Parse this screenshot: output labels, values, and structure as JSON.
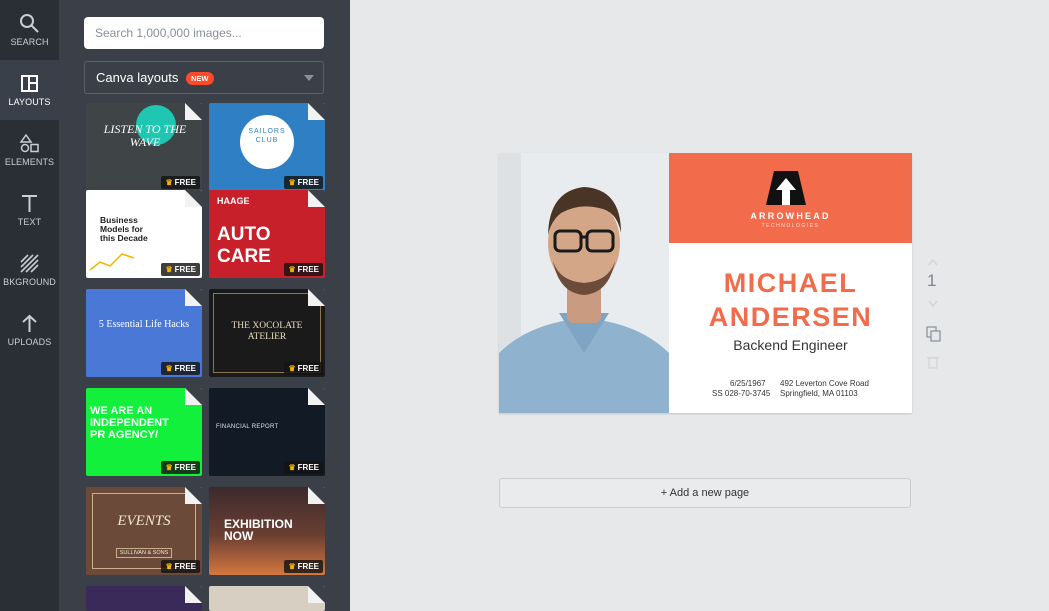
{
  "sidebar": {
    "items": [
      {
        "label": "SEARCH",
        "icon": "search-icon"
      },
      {
        "label": "LAYOUTS",
        "icon": "layouts-icon",
        "active": true
      },
      {
        "label": "ELEMENTS",
        "icon": "elements-icon"
      },
      {
        "label": "TEXT",
        "icon": "text-icon"
      },
      {
        "label": "BKGROUND",
        "icon": "background-icon"
      },
      {
        "label": "UPLOADS",
        "icon": "upload-icon"
      }
    ]
  },
  "panel": {
    "search_placeholder": "Search 1,000,000 images...",
    "layout_select": {
      "label": "Canva layouts",
      "badge": "NEW"
    },
    "free_label": "FREE",
    "templates": [
      {
        "title": "LISTEN TO THE WAVE"
      },
      {
        "title": "SAILORS",
        "subtitle": "CLUB"
      },
      {
        "title": "Business Models for this Decade"
      },
      {
        "title": "AUTO CARE",
        "subtitle": "HAAGE"
      },
      {
        "title": "5 Essential Life Hacks"
      },
      {
        "title": "THE XOCOLATE ATELIER"
      },
      {
        "title": "WE ARE AN INDEPENDENT PR AGENCY/"
      },
      {
        "title": "FINANCIAL REPORT"
      },
      {
        "title": "EVENTS",
        "subtitle": "SULLIVAN & SONS"
      },
      {
        "title": "EXHIBITION NOW"
      }
    ]
  },
  "card": {
    "company": "ARROWHEAD",
    "tagline": "TECHNOLOGIES",
    "first_name": "MICHAEL",
    "last_name": "ANDERSEN",
    "role": "Backend Engineer",
    "dob": "6/25/1967",
    "ssn": "SS 028-70-3745",
    "address_line1": "492 Leverton Cove Road",
    "address_line2": "Springfield, MA 01103",
    "accent_color": "#f26b4a"
  },
  "page_number": "1",
  "add_page_label": "+ Add a new page"
}
